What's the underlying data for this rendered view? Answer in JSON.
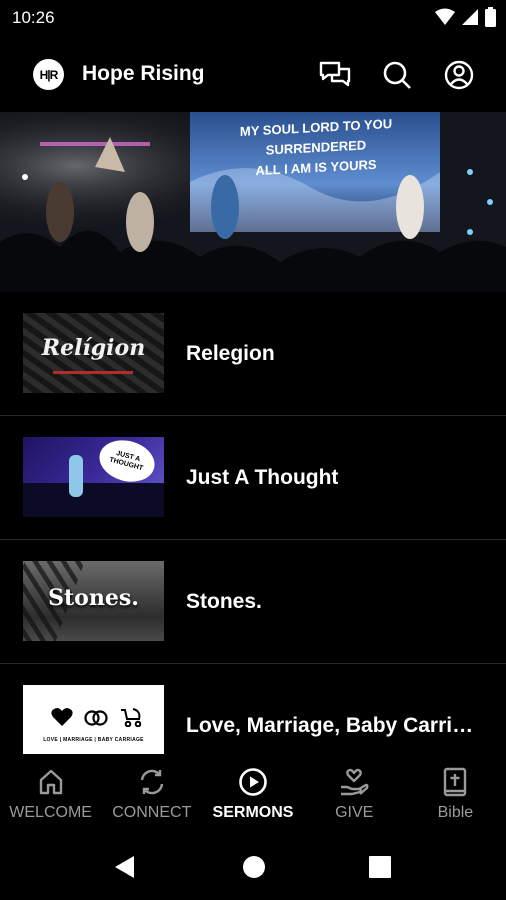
{
  "status_bar": {
    "time": "10:26"
  },
  "app_bar": {
    "logo_text": "H|R",
    "title": "Hope Rising"
  },
  "hero": {
    "screen_text_line1": "MY SOUL LORD TO YOU SURRENDERED",
    "screen_text_line2": "ALL I AM IS YOURS"
  },
  "sermons": [
    {
      "title": "Relegion",
      "thumb_text": "Relígion"
    },
    {
      "title": "Just A Thought",
      "thumb_text": "JUST A THOUGHT"
    },
    {
      "title": "Stones.",
      "thumb_text": "Stones."
    },
    {
      "title": "Love, Marriage, Baby Carri…",
      "thumb_text": "LOVE | MARRIAGE | BABY CARRIAGE"
    }
  ],
  "bottom_nav": [
    {
      "label": "WELCOME",
      "icon": "home-icon",
      "active": false
    },
    {
      "label": "CONNECT",
      "icon": "sync-icon",
      "active": false
    },
    {
      "label": "SERMONS",
      "icon": "play-circle-icon",
      "active": true
    },
    {
      "label": "GIVE",
      "icon": "hand-heart-icon",
      "active": false
    },
    {
      "label": "Bible",
      "icon": "bible-icon",
      "active": false
    }
  ],
  "colors": {
    "background": "#000000",
    "inactive": "#9a9a9a",
    "active": "#ffffff"
  }
}
